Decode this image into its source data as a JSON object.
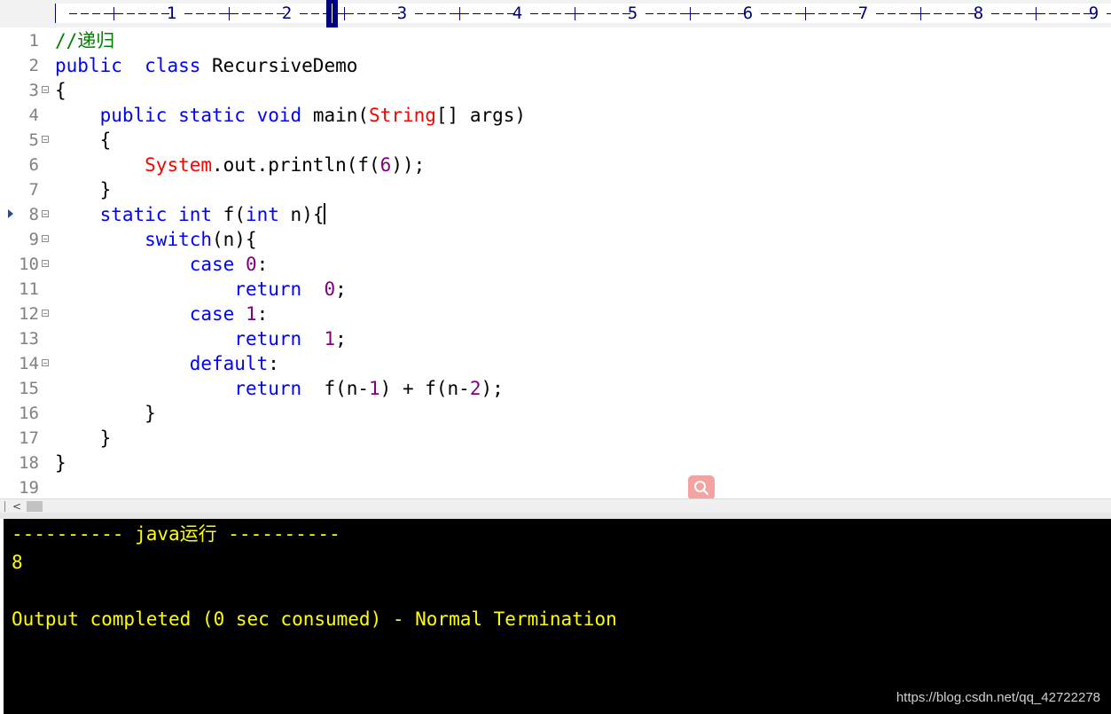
{
  "ruler": {
    "numbers": [
      "1",
      "2",
      "3",
      "4",
      "5",
      "6",
      "7",
      "8",
      "9"
    ]
  },
  "editor": {
    "line_numbers": [
      "1",
      "2",
      "3",
      "4",
      "5",
      "6",
      "7",
      "8",
      "9",
      "10",
      "11",
      "12",
      "13",
      "14",
      "15",
      "16",
      "17",
      "18",
      "19"
    ],
    "lines": [
      [
        [
          "cmt",
          "//递归"
        ]
      ],
      [
        [
          "kw",
          "public"
        ],
        [
          "",
          "  "
        ],
        [
          "kw",
          "class"
        ],
        [
          "",
          " RecursiveDemo"
        ]
      ],
      [
        [
          "",
          "{"
        ]
      ],
      [
        [
          "",
          "    "
        ],
        [
          "kw",
          "public"
        ],
        [
          "",
          " "
        ],
        [
          "kw",
          "static"
        ],
        [
          "",
          " "
        ],
        [
          "kw",
          "void"
        ],
        [
          "",
          " main("
        ],
        [
          "cls",
          "String"
        ],
        [
          "",
          "[] args)"
        ]
      ],
      [
        [
          "",
          "    {"
        ]
      ],
      [
        [
          "",
          "        "
        ],
        [
          "cls",
          "System"
        ],
        [
          "",
          ".out.println(f("
        ],
        [
          "num",
          "6"
        ],
        [
          "",
          "));"
        ]
      ],
      [
        [
          "",
          "    }"
        ]
      ],
      [
        [
          "",
          "    "
        ],
        [
          "kw",
          "static"
        ],
        [
          "",
          " "
        ],
        [
          "kw",
          "int"
        ],
        [
          "",
          " f("
        ],
        [
          "kw",
          "int"
        ],
        [
          "",
          " n){"
        ]
      ],
      [
        [
          "",
          "        "
        ],
        [
          "kw",
          "switch"
        ],
        [
          "",
          "(n){"
        ]
      ],
      [
        [
          "",
          "            "
        ],
        [
          "kw",
          "case"
        ],
        [
          "",
          " "
        ],
        [
          "num",
          "0"
        ],
        [
          "",
          ":"
        ]
      ],
      [
        [
          "",
          "                "
        ],
        [
          "kw",
          "return"
        ],
        [
          "",
          "  "
        ],
        [
          "num",
          "0"
        ],
        [
          "",
          ";"
        ]
      ],
      [
        [
          "",
          "            "
        ],
        [
          "kw",
          "case"
        ],
        [
          "",
          " "
        ],
        [
          "num",
          "1"
        ],
        [
          "",
          ":"
        ]
      ],
      [
        [
          "",
          "                "
        ],
        [
          "kw",
          "return"
        ],
        [
          "",
          "  "
        ],
        [
          "num",
          "1"
        ],
        [
          "",
          ";"
        ]
      ],
      [
        [
          "",
          "            "
        ],
        [
          "kw",
          "default"
        ],
        [
          "",
          ":"
        ]
      ],
      [
        [
          "",
          "                "
        ],
        [
          "kw",
          "return"
        ],
        [
          "",
          "  f(n-"
        ],
        [
          "num",
          "1"
        ],
        [
          "",
          ") + f(n-"
        ],
        [
          "num",
          "2"
        ],
        [
          "",
          ");"
        ]
      ],
      [
        [
          "",
          "        }"
        ]
      ],
      [
        [
          "",
          "    }"
        ]
      ],
      [
        [
          "",
          "}"
        ]
      ],
      [
        [
          "",
          ""
        ]
      ]
    ],
    "fold_lines": [
      3,
      5,
      8,
      9,
      10,
      12,
      14
    ],
    "current_line": 8
  },
  "scrollbar": {
    "left_arrow": "<"
  },
  "output": {
    "header": "---------- java运行 ----------",
    "result": "8",
    "status": "Output completed (0 sec consumed) - Normal Termination"
  },
  "watermark": "https://blog.csdn.net/qq_42722278",
  "colors": {
    "keyword": "#0000ff",
    "comment": "#008000",
    "class": "#ff0000",
    "number": "#800080",
    "output_text": "#ffff00",
    "output_bg": "#000000"
  }
}
